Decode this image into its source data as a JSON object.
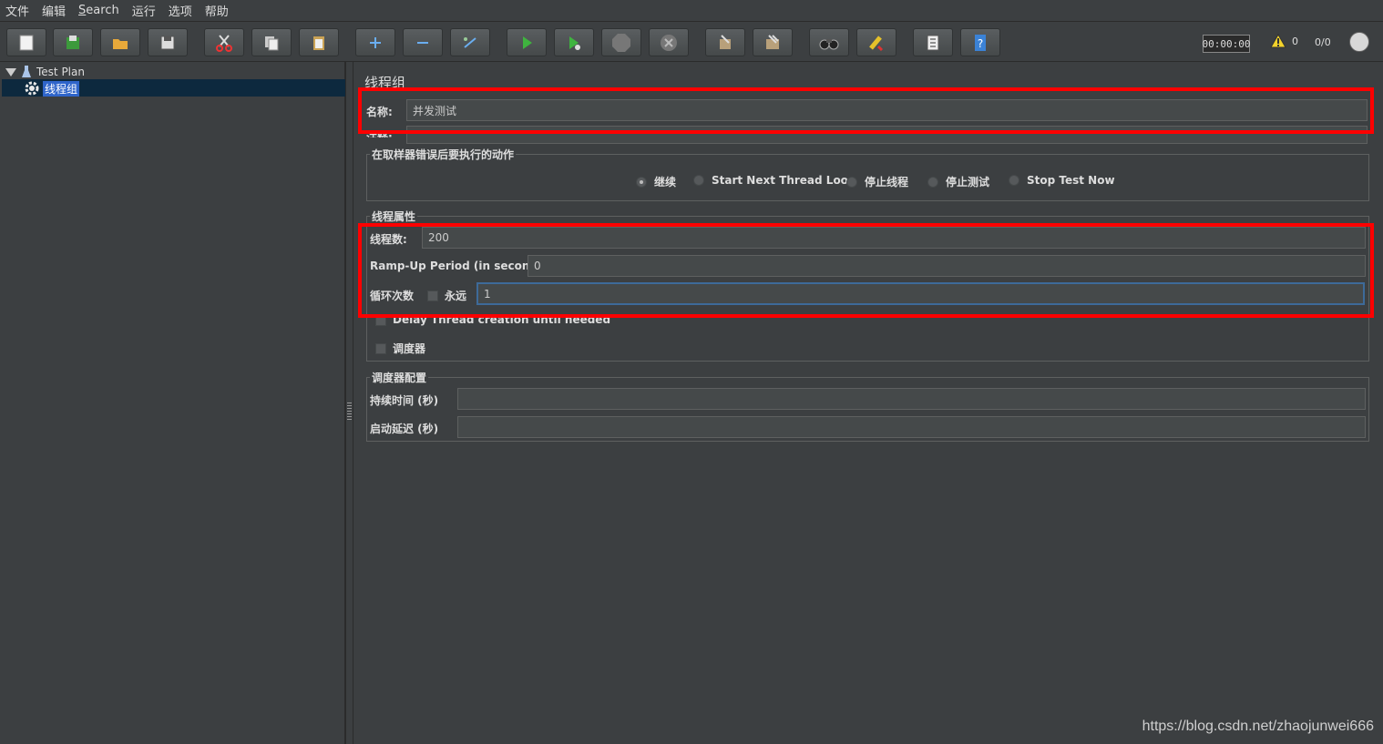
{
  "menu": [
    "文件",
    "编辑",
    "Search",
    "运行",
    "选项",
    "帮助"
  ],
  "toolbar": {
    "buttons": [
      "new-icon",
      "templates-icon",
      "open-icon",
      "save-icon",
      "cut-icon",
      "copy-icon",
      "paste-icon",
      "expand-icon",
      "collapse-icon",
      "toggle-icon",
      "start-icon",
      "start-no-pause-icon",
      "stop-icon",
      "shutdown-icon",
      "clear-icon",
      "clear-all-icon",
      "search-icon",
      "reset-search-icon",
      "function-helper-icon",
      "help-icon"
    ],
    "timer": "00:00:00",
    "warning_count": "0",
    "thread_ratio": "0/0"
  },
  "tree": {
    "root": "Test Plan",
    "child": "线程组"
  },
  "form": {
    "title": "线程组",
    "name_label": "名称:",
    "name_value": "并发测试",
    "comment_label": "注释:",
    "error_group_title": "在取样器错误后要执行的动作",
    "error_options": [
      "继续",
      "Start Next Thread Loop",
      "停止线程",
      "停止测试",
      "Stop Test Now"
    ],
    "error_selected": "继续",
    "thread_group_title": "线程属性",
    "threads_label": "线程数:",
    "threads_value": "200",
    "rampup_label": "Ramp-Up Period (in seconds):",
    "rampup_value": "0",
    "loop_label": "循环次数",
    "forever_label": "永远",
    "loop_value": "1",
    "delay_label": "Delay Thread creation until needed",
    "scheduler_label": "调度器",
    "scheduler_group_title": "调度器配置",
    "duration_label": "持续时间 (秒)",
    "duration_value": "",
    "startup_delay_label": "启动延迟 (秒)",
    "startup_delay_value": ""
  },
  "watermark": "https://blog.csdn.net/zhaojunwei666",
  "colors": {
    "highlight": "#ff0000",
    "selection": "#2f65ca",
    "background": "#3c3f41"
  }
}
